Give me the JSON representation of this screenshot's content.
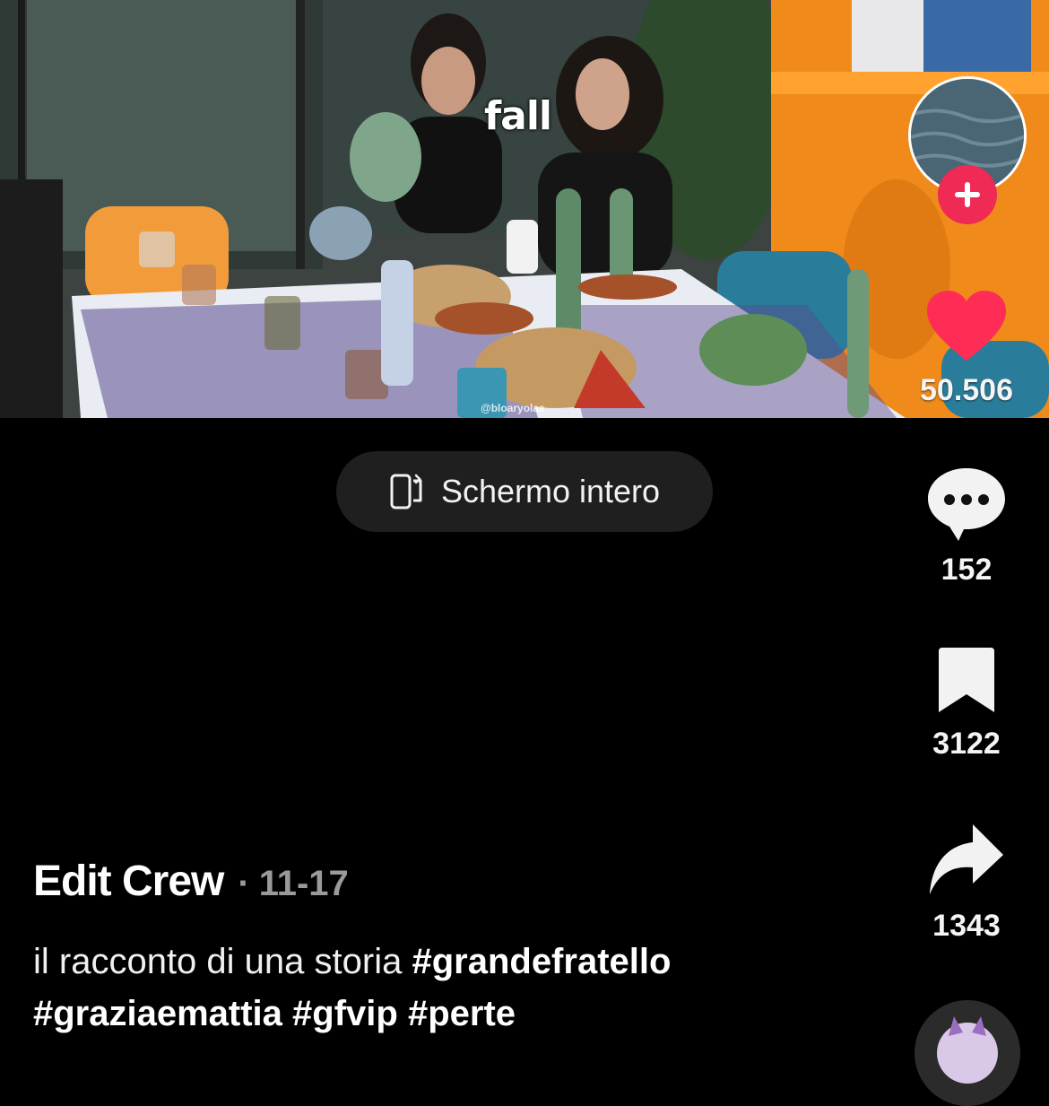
{
  "video": {
    "overlay_text": "fall",
    "watermark": "@bloaryolas"
  },
  "fullscreen": {
    "label": "Schermo intero",
    "icon": "rotate-phone-icon"
  },
  "rail": {
    "likes": {
      "icon": "heart-icon",
      "count": "50.506",
      "color": "#ff2d55"
    },
    "comments": {
      "icon": "comment-bubble-icon",
      "count": "152"
    },
    "saves": {
      "icon": "bookmark-icon",
      "count": "3122"
    },
    "shares": {
      "icon": "share-arrow-icon",
      "count": "1343"
    },
    "follow": {
      "icon": "plus-icon",
      "color": "#ee2a55"
    },
    "avatar": {
      "icon": "avatar"
    },
    "music": {
      "icon": "music-disc-icon"
    }
  },
  "post": {
    "author": "Edit Crew",
    "date": "11-17",
    "description_text": "il racconto di una storia ",
    "hashtags": [
      "#grandefratello",
      "#graziaemattia",
      "#gfvip",
      "#perte"
    ]
  }
}
